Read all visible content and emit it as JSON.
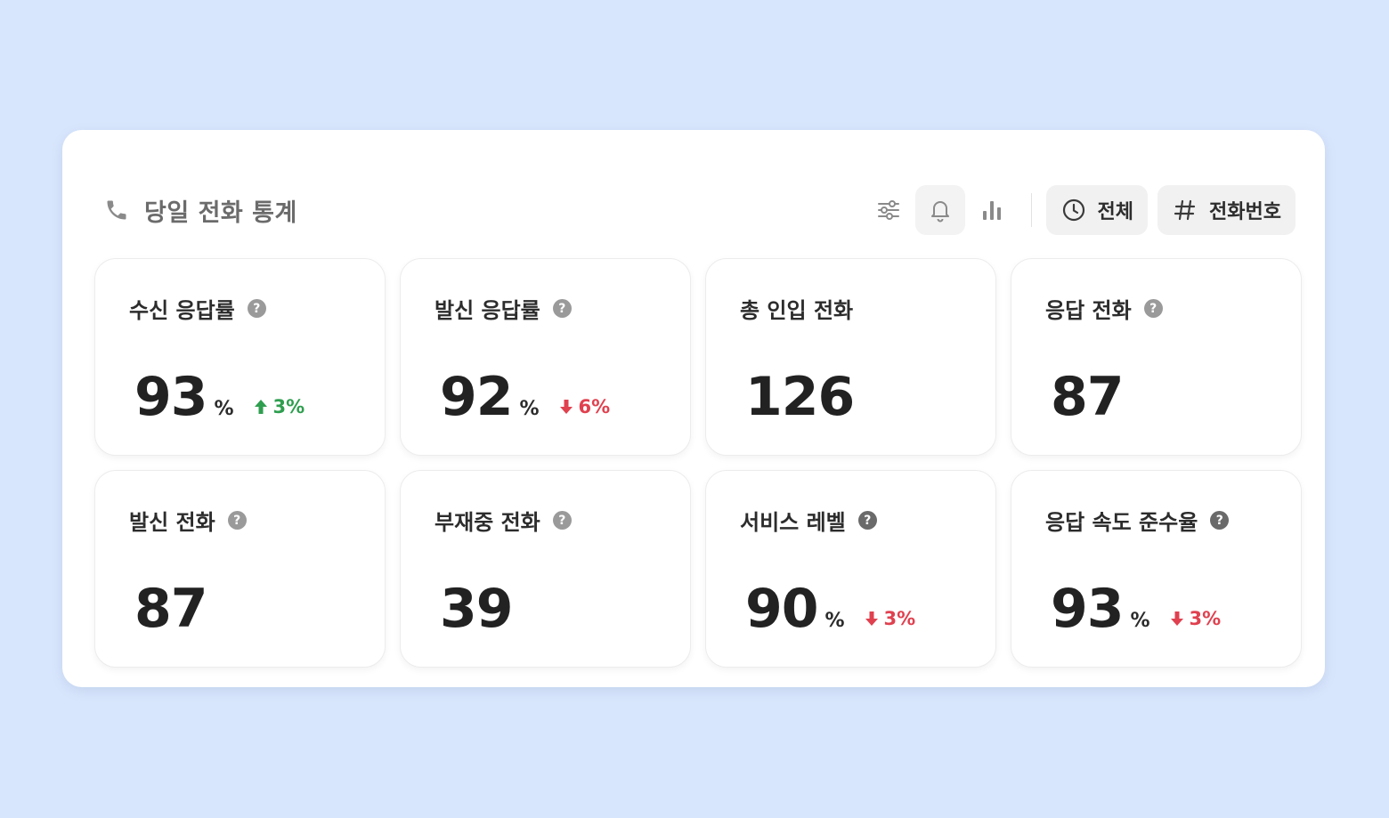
{
  "header": {
    "title": "당일 전화 통계",
    "filter_all_label": "전체",
    "filter_number_label": "전화번호"
  },
  "colors": {
    "background": "#d8e6fd",
    "up": "#2f9e4f",
    "down": "#e0414f"
  },
  "cards": [
    {
      "label": "수신 응답률",
      "value": "93",
      "unit": "%",
      "delta": "3%",
      "trend": "up",
      "help": true
    },
    {
      "label": "발신 응답률",
      "value": "92",
      "unit": "%",
      "delta": "6%",
      "trend": "down",
      "help": true
    },
    {
      "label": "총 인입 전화",
      "value": "126",
      "unit": "",
      "delta": "",
      "trend": "",
      "help": false
    },
    {
      "label": "응답 전화",
      "value": "87",
      "unit": "",
      "delta": "",
      "trend": "",
      "help": true
    },
    {
      "label": "발신 전화",
      "value": "87",
      "unit": "",
      "delta": "",
      "trend": "",
      "help": true
    },
    {
      "label": "부재중 전화",
      "value": "39",
      "unit": "",
      "delta": "",
      "trend": "",
      "help": true
    },
    {
      "label": "서비스 레벨",
      "value": "90",
      "unit": "%",
      "delta": "3%",
      "trend": "down",
      "help": true
    },
    {
      "label": "응답 속도 준수율",
      "value": "93",
      "unit": "%",
      "delta": "3%",
      "trend": "down",
      "help": true
    }
  ],
  "help_glyph": "?"
}
